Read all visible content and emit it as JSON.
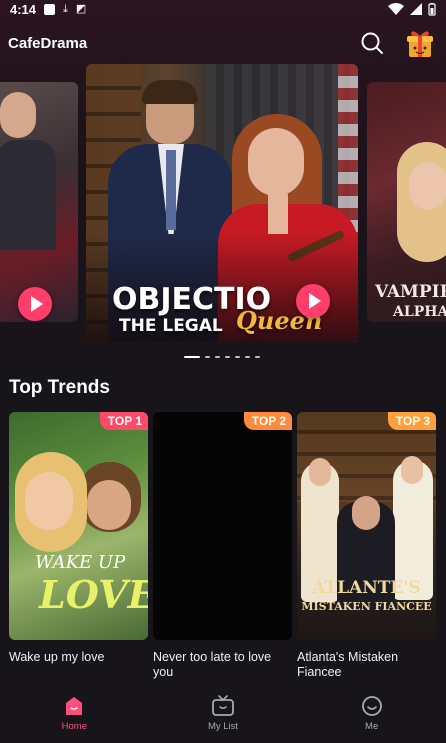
{
  "status_bar": {
    "time": "4:14"
  },
  "header": {
    "app_title": "CafeDrama"
  },
  "carousel": {
    "center": {
      "title_main": "OBJECTIO",
      "title_sub": "THE LEGAL",
      "title_script": "Queen"
    },
    "right": {
      "title_line1": "VAMPIR",
      "title_line2": "ALPHA"
    },
    "indicator_count": 7,
    "active_index": 0
  },
  "section": {
    "title": "Top Trends"
  },
  "cards": [
    {
      "rank": "TOP 1",
      "caption": "Wake up my love",
      "poster_text_a": "WAKE UP",
      "poster_text_b": "LOVE"
    },
    {
      "rank": "TOP 2",
      "caption": "Never too late to love you"
    },
    {
      "rank": "TOP 3",
      "caption": "Atlanta's Mistaken Fiancee",
      "poster_text_a": "ATLANTE'S",
      "poster_text_b": "MISTAKEN FIANCEE"
    }
  ],
  "bottom_nav": {
    "items": [
      {
        "label": "Home",
        "icon": "home-icon",
        "active": true
      },
      {
        "label": "My List",
        "icon": "tv-icon",
        "active": false
      },
      {
        "label": "Me",
        "icon": "smile-icon",
        "active": false
      }
    ]
  },
  "colors": {
    "accent": "#ff4f7a",
    "play_button": "#ff3e6c",
    "background": "#17141a"
  }
}
